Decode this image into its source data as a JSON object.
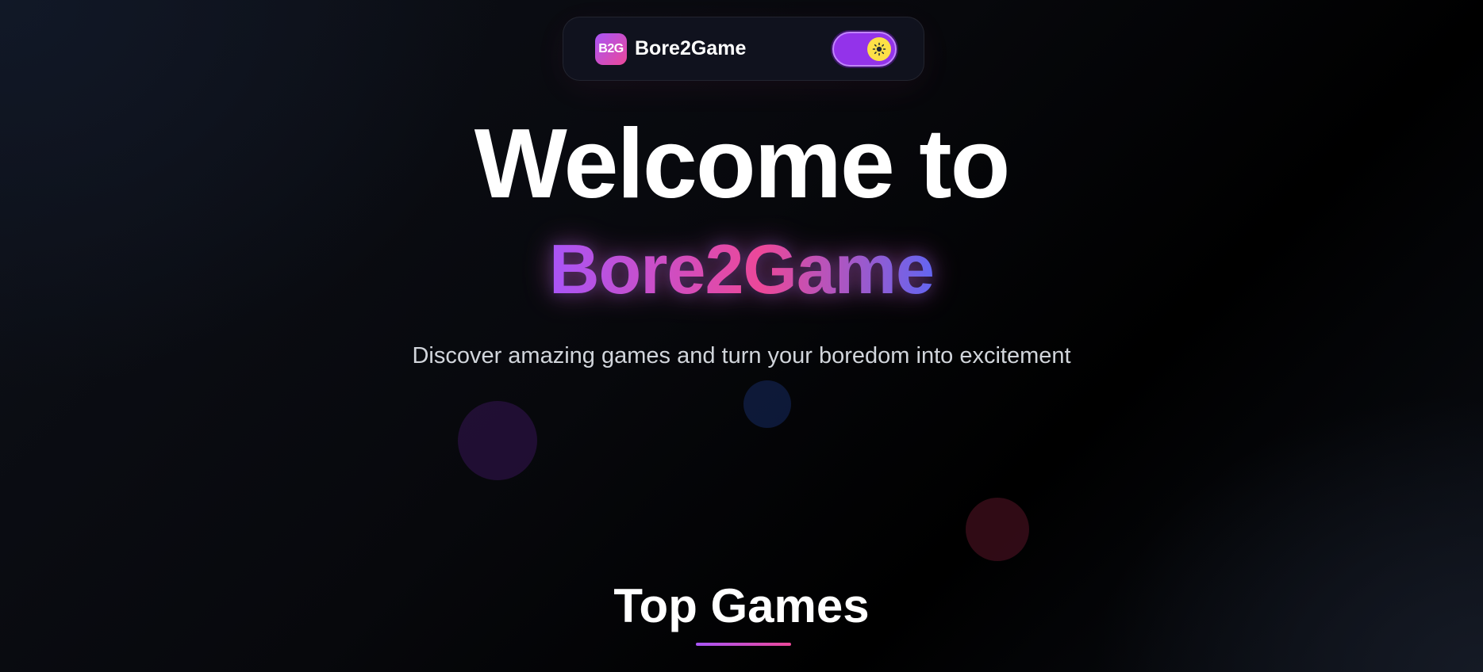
{
  "navbar": {
    "logo_text": "B2G",
    "brand_name": "Bore2Game",
    "theme_toggle": {
      "state": "on",
      "icon": "sun-icon"
    }
  },
  "hero": {
    "title": "Welcome to",
    "brand": "Bore2Game",
    "subtitle": "Discover amazing games and turn your boredom into excitement"
  },
  "section": {
    "title": "Top Games"
  },
  "colors": {
    "accent_purple": "#a855f7",
    "accent_pink": "#ec4899",
    "toggle_bg": "#9333ea",
    "toggle_knob": "#fde047"
  }
}
